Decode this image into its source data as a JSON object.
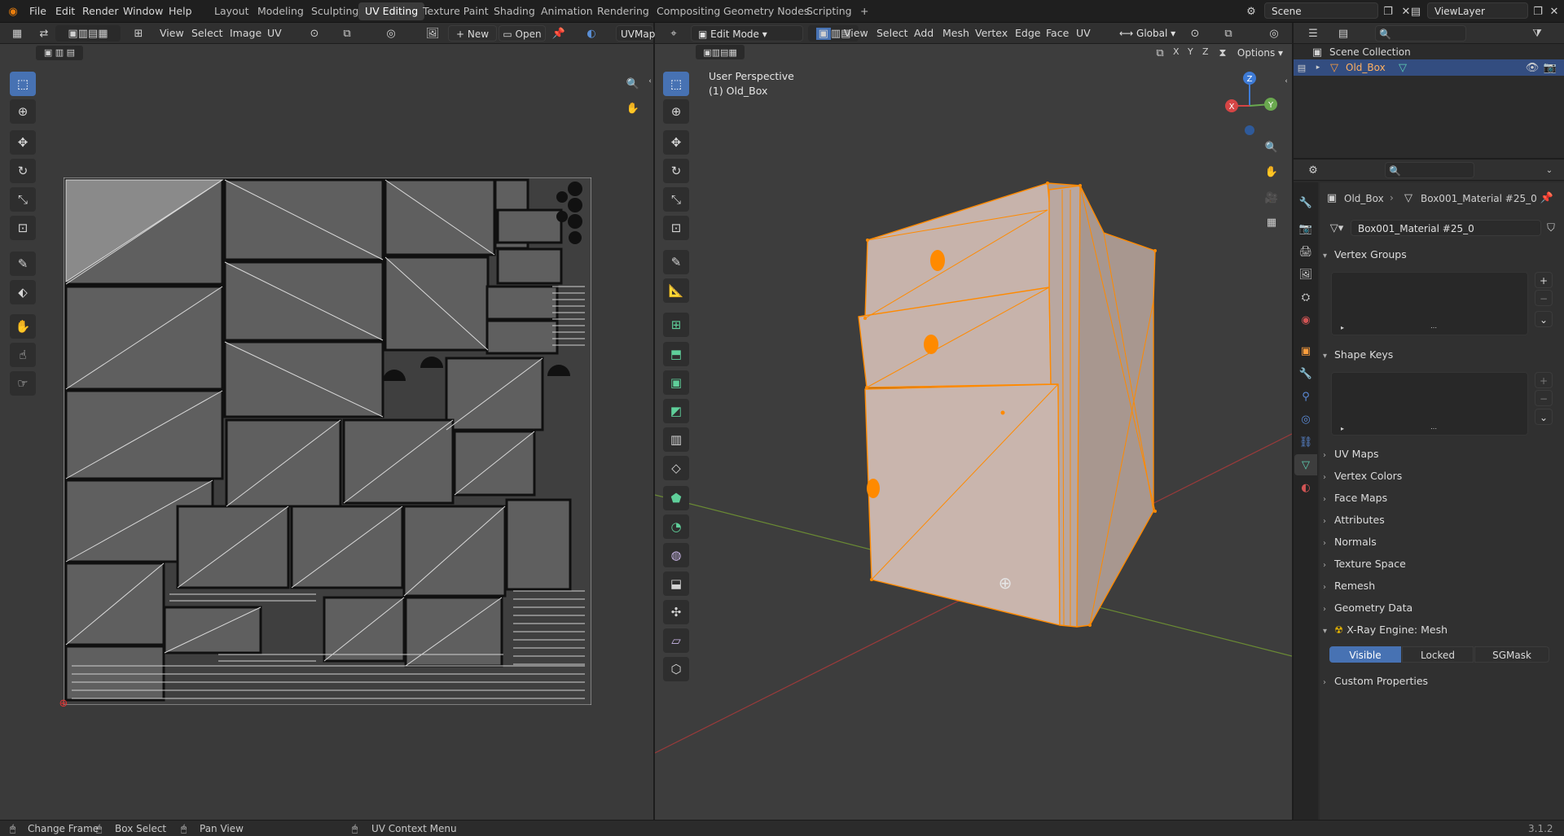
{
  "topbar": {
    "menus": [
      "File",
      "Edit",
      "Render",
      "Window",
      "Help"
    ],
    "workspaces": [
      "Layout",
      "Modeling",
      "Sculpting",
      "UV Editing",
      "Texture Paint",
      "Shading",
      "Animation",
      "Rendering",
      "Compositing",
      "Geometry Nodes",
      "Scripting"
    ],
    "active_workspace": "UV Editing",
    "add_tab": "+",
    "scene_name": "Scene",
    "view_layer": "ViewLayer"
  },
  "uv_editor": {
    "menus": [
      "View",
      "Select",
      "Image",
      "UV"
    ],
    "new_label": "New",
    "open_label": "Open",
    "uvmap_label": "UVMap"
  },
  "viewport": {
    "mode": "Edit Mode",
    "menus": [
      "View",
      "Select",
      "Add",
      "Mesh",
      "Vertex",
      "Edge",
      "Face",
      "UV"
    ],
    "orientation": "Global",
    "axes": [
      "X",
      "Y",
      "Z"
    ],
    "options_label": "Options",
    "perspective": "User Perspective",
    "object_label": "(1) Old_Box",
    "gizmo": {
      "z": "Z",
      "x": "X",
      "y": "Y"
    }
  },
  "outliner": {
    "collection": "Scene Collection",
    "object": "Old_Box"
  },
  "properties": {
    "breadcrumb_object": "Old_Box",
    "breadcrumb_mesh": "Box001_Material #25_0",
    "mesh_name": "Box001_Material #25_0",
    "panels_open": [
      "Vertex Groups",
      "Shape Keys"
    ],
    "panels_closed": [
      "UV Maps",
      "Vertex Colors",
      "Face Maps",
      "Attributes",
      "Normals",
      "Texture Space",
      "Remesh",
      "Geometry Data"
    ],
    "xray_panel": "X-Ray Engine: Mesh",
    "xray_buttons": [
      "Visible",
      "Locked",
      "SGMask"
    ],
    "custom_props": "Custom Properties"
  },
  "statusbar": {
    "change_frame": "Change Frame",
    "box_select": "Box Select",
    "pan_view": "Pan View",
    "context_menu": "UV Context Menu",
    "version": "3.1.2"
  },
  "colors": {
    "accent": "#4772b3",
    "selection": "#ff8a00",
    "uv_fill": "#808080",
    "viewport_bg": "#3d3d3d",
    "uv_bg": "#3a3a3a"
  }
}
